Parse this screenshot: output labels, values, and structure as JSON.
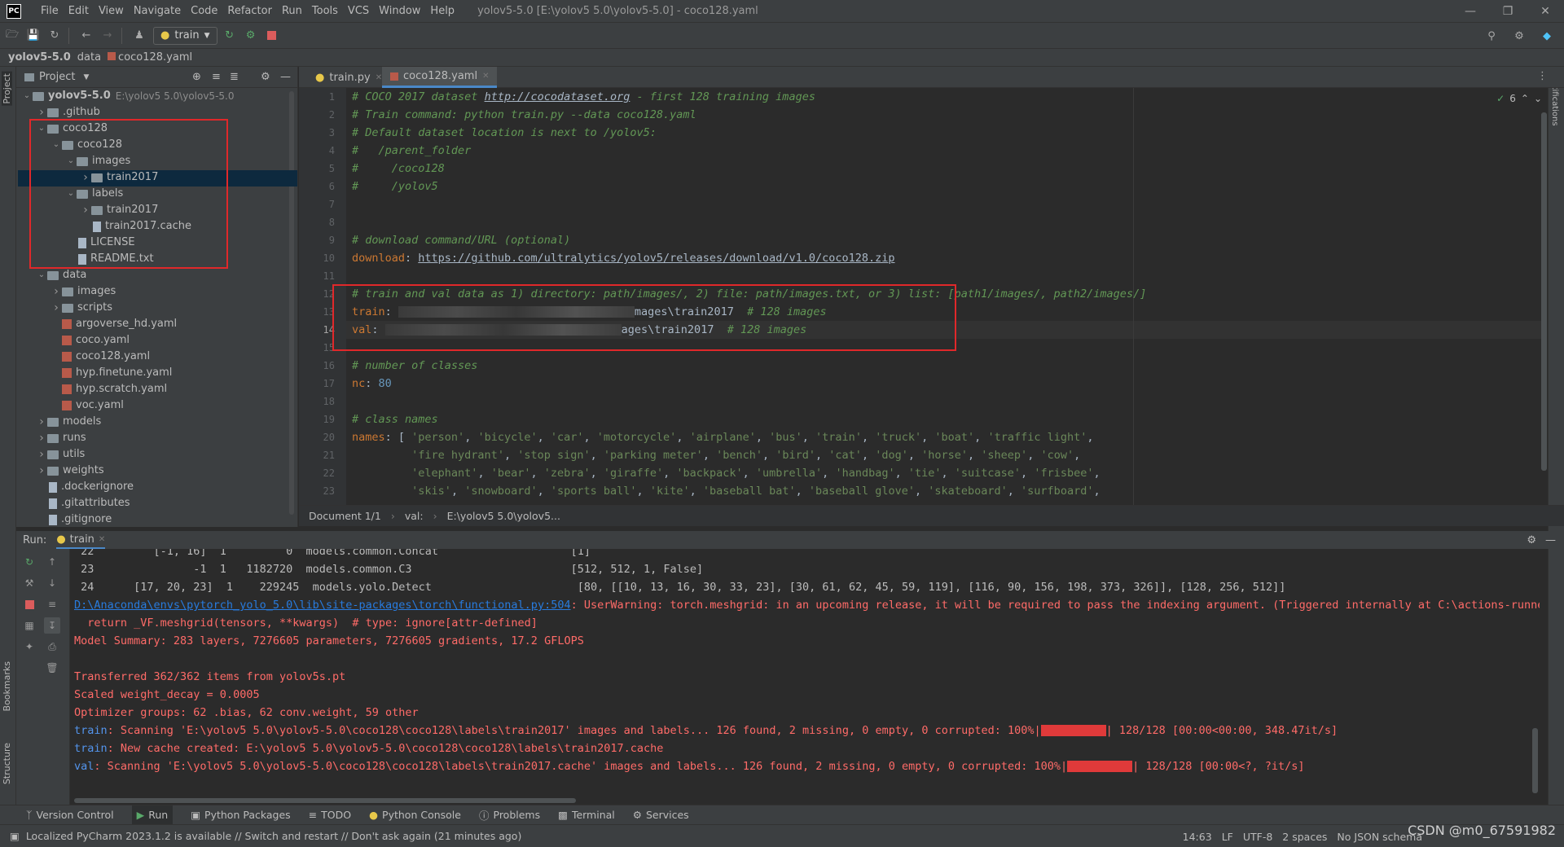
{
  "window": {
    "logo": "PC",
    "title": "yolov5-5.0 [E:\\yolov5 5.0\\yolov5-5.0] - coco128.yaml",
    "menu": [
      "File",
      "Edit",
      "View",
      "Navigate",
      "Code",
      "Refactor",
      "Run",
      "Tools",
      "VCS",
      "Window",
      "Help"
    ]
  },
  "toolbar": {
    "run_config": "train"
  },
  "breadcrumb": [
    "yolov5-5.0",
    "data",
    "coco128.yaml"
  ],
  "side_tabs": {
    "project": "Project",
    "bookmarks": "Bookmarks",
    "structure": "Structure",
    "notifications": "Notifications"
  },
  "project": {
    "header": "Project",
    "tree": [
      {
        "label": "yolov5-5.0",
        "hint": "E:\\yolov5 5.0\\yolov5-5.0",
        "kind": "folder",
        "depth": 0,
        "open": true,
        "bold": true
      },
      {
        "label": ".github",
        "kind": "folder",
        "depth": 1,
        "open": false
      },
      {
        "label": "coco128",
        "kind": "folder",
        "depth": 1,
        "open": true
      },
      {
        "label": "coco128",
        "kind": "folder",
        "depth": 2,
        "open": true
      },
      {
        "label": "images",
        "kind": "folder",
        "depth": 3,
        "open": true
      },
      {
        "label": "train2017",
        "kind": "folder",
        "depth": 4,
        "open": false,
        "selected": true
      },
      {
        "label": "labels",
        "kind": "folder",
        "depth": 3,
        "open": true
      },
      {
        "label": "train2017",
        "kind": "folder",
        "depth": 4,
        "open": false
      },
      {
        "label": "train2017.cache",
        "kind": "file",
        "depth": 4
      },
      {
        "label": "LICENSE",
        "kind": "file",
        "depth": 3
      },
      {
        "label": "README.txt",
        "kind": "file",
        "depth": 3
      },
      {
        "label": "data",
        "kind": "folder",
        "depth": 1,
        "open": true
      },
      {
        "label": "images",
        "kind": "folder",
        "depth": 2,
        "open": false
      },
      {
        "label": "scripts",
        "kind": "folder",
        "depth": 2,
        "open": false
      },
      {
        "label": "argoverse_hd.yaml",
        "kind": "yaml",
        "depth": 2
      },
      {
        "label": "coco.yaml",
        "kind": "yaml",
        "depth": 2
      },
      {
        "label": "coco128.yaml",
        "kind": "yaml",
        "depth": 2
      },
      {
        "label": "hyp.finetune.yaml",
        "kind": "yaml",
        "depth": 2
      },
      {
        "label": "hyp.scratch.yaml",
        "kind": "yaml",
        "depth": 2
      },
      {
        "label": "voc.yaml",
        "kind": "yaml",
        "depth": 2
      },
      {
        "label": "models",
        "kind": "folder",
        "depth": 1,
        "open": false
      },
      {
        "label": "runs",
        "kind": "folder",
        "depth": 1,
        "open": false
      },
      {
        "label": "utils",
        "kind": "folder",
        "depth": 1,
        "open": false
      },
      {
        "label": "weights",
        "kind": "folder",
        "depth": 1,
        "open": false
      },
      {
        "label": ".dockerignore",
        "kind": "file",
        "depth": 1
      },
      {
        "label": ".gitattributes",
        "kind": "file",
        "depth": 1
      },
      {
        "label": ".gitignore",
        "kind": "file",
        "depth": 1
      }
    ]
  },
  "editor": {
    "tabs": [
      {
        "label": "train.py",
        "active": false
      },
      {
        "label": "coco128.yaml",
        "active": true
      }
    ],
    "inspection_count": "6",
    "breadcrumb": [
      "Document 1/1",
      "val:",
      "E:\\yolov5 5.0\\yolov5..."
    ],
    "lines": [
      [
        [
          "cm",
          "# COCO 2017 dataset "
        ],
        [
          "cm link",
          "http://cocodataset.org"
        ],
        [
          "cm",
          " - first 128 training images"
        ]
      ],
      [
        [
          "cm",
          "# Train command: python train.py --data coco128.yaml"
        ]
      ],
      [
        [
          "cm",
          "# Default dataset location is next to /yolov5:"
        ]
      ],
      [
        [
          "cm",
          "#   /parent_folder"
        ]
      ],
      [
        [
          "cm",
          "#     /coco128"
        ]
      ],
      [
        [
          "cm",
          "#     /yolov5"
        ]
      ],
      [],
      [],
      [
        [
          "cm",
          "# download command/URL (optional)"
        ]
      ],
      [
        [
          "key",
          "download"
        ],
        [
          "plain",
          ": "
        ],
        [
          "link",
          "https://github.com/ultralytics/yolov5/releases/download/v1.0/coco128.zip"
        ]
      ],
      [],
      [
        [
          "cm",
          "# train and val data as 1) directory: path/images/, 2) file: path/images.txt, or 3) list: [path1/images/, path2/images/]"
        ]
      ],
      [
        [
          "key",
          "train"
        ],
        [
          "plain",
          ": "
        ],
        [
          "blur",
          "                                     "
        ],
        [
          "plain",
          "mages\\train2017  "
        ],
        [
          "cm",
          "# 128 images"
        ]
      ],
      [
        [
          "key",
          "val"
        ],
        [
          "plain",
          ": "
        ],
        [
          "blur",
          "                                     "
        ],
        [
          "plain",
          "ages\\train2017  "
        ],
        [
          "cm",
          "# 128 images"
        ]
      ],
      [],
      [
        [
          "cm",
          "# number of classes"
        ]
      ],
      [
        [
          "key",
          "nc"
        ],
        [
          "plain",
          ": "
        ],
        [
          "num",
          "80"
        ]
      ],
      [],
      [
        [
          "cm",
          "# class names"
        ]
      ],
      [
        [
          "key",
          "names"
        ],
        [
          "plain",
          ": [ "
        ],
        [
          "str",
          "'person'"
        ],
        [
          "plain",
          ", "
        ],
        [
          "str",
          "'bicycle'"
        ],
        [
          "plain",
          ", "
        ],
        [
          "str",
          "'car'"
        ],
        [
          "plain",
          ", "
        ],
        [
          "str",
          "'motorcycle'"
        ],
        [
          "plain",
          ", "
        ],
        [
          "str",
          "'airplane'"
        ],
        [
          "plain",
          ", "
        ],
        [
          "str",
          "'bus'"
        ],
        [
          "plain",
          ", "
        ],
        [
          "str",
          "'train'"
        ],
        [
          "plain",
          ", "
        ],
        [
          "str",
          "'truck'"
        ],
        [
          "plain",
          ", "
        ],
        [
          "str",
          "'boat'"
        ],
        [
          "plain",
          ", "
        ],
        [
          "str",
          "'traffic light'"
        ],
        [
          "plain",
          ","
        ]
      ],
      [
        [
          "plain",
          "         "
        ],
        [
          "str",
          "'fire hydrant'"
        ],
        [
          "plain",
          ", "
        ],
        [
          "str",
          "'stop sign'"
        ],
        [
          "plain",
          ", "
        ],
        [
          "str",
          "'parking meter'"
        ],
        [
          "plain",
          ", "
        ],
        [
          "str",
          "'bench'"
        ],
        [
          "plain",
          ", "
        ],
        [
          "str",
          "'bird'"
        ],
        [
          "plain",
          ", "
        ],
        [
          "str",
          "'cat'"
        ],
        [
          "plain",
          ", "
        ],
        [
          "str",
          "'dog'"
        ],
        [
          "plain",
          ", "
        ],
        [
          "str",
          "'horse'"
        ],
        [
          "plain",
          ", "
        ],
        [
          "str",
          "'sheep'"
        ],
        [
          "plain",
          ", "
        ],
        [
          "str",
          "'cow'"
        ],
        [
          "plain",
          ","
        ]
      ],
      [
        [
          "plain",
          "         "
        ],
        [
          "str",
          "'elephant'"
        ],
        [
          "plain",
          ", "
        ],
        [
          "str",
          "'bear'"
        ],
        [
          "plain",
          ", "
        ],
        [
          "str",
          "'zebra'"
        ],
        [
          "plain",
          ", "
        ],
        [
          "str",
          "'giraffe'"
        ],
        [
          "plain",
          ", "
        ],
        [
          "str",
          "'backpack'"
        ],
        [
          "plain",
          ", "
        ],
        [
          "str",
          "'umbrella'"
        ],
        [
          "plain",
          ", "
        ],
        [
          "str",
          "'handbag'"
        ],
        [
          "plain",
          ", "
        ],
        [
          "str",
          "'tie'"
        ],
        [
          "plain",
          ", "
        ],
        [
          "str",
          "'suitcase'"
        ],
        [
          "plain",
          ", "
        ],
        [
          "str",
          "'frisbee'"
        ],
        [
          "plain",
          ","
        ]
      ],
      [
        [
          "plain",
          "         "
        ],
        [
          "str",
          "'skis'"
        ],
        [
          "plain",
          ", "
        ],
        [
          "str",
          "'snowboard'"
        ],
        [
          "plain",
          ", "
        ],
        [
          "str",
          "'sports ball'"
        ],
        [
          "plain",
          ", "
        ],
        [
          "str",
          "'kite'"
        ],
        [
          "plain",
          ", "
        ],
        [
          "str",
          "'baseball bat'"
        ],
        [
          "plain",
          ", "
        ],
        [
          "str",
          "'baseball glove'"
        ],
        [
          "plain",
          ", "
        ],
        [
          "str",
          "'skateboard'"
        ],
        [
          "plain",
          ", "
        ],
        [
          "str",
          "'surfboard'"
        ],
        [
          "plain",
          ","
        ]
      ]
    ]
  },
  "run": {
    "label": "Run:",
    "tab": "train",
    "console": [
      [
        [
          "out",
          " 22         [-1, 16]  1         0  models.common.Concat                    [1]"
        ]
      ],
      [
        [
          "out",
          " 23               -1  1   1182720  models.common.C3                        [512, 512, 1, False]"
        ]
      ],
      [
        [
          "out",
          " 24      [17, 20, 23]  1    229245  models.yolo.Detect                      [80, [[10, 13, 16, 30, 33, 23], [30, 61, 62, 45, 59, 119], [116, 90, 156, 198, 373, 326]], [128, 256, 512]]"
        ]
      ],
      [
        [
          "ulink",
          "D:\\Anaconda\\envs\\pytorch_yolo_5.0\\lib\\site-packages\\torch\\functional.py:504"
        ],
        [
          "err",
          ": UserWarning: torch.meshgrid: in an upcoming release, it will be required to pass the indexing argument. (Triggered internally at C:\\actions-runner\\_w"
        ]
      ],
      [
        [
          "err",
          "  return _VF.meshgrid(tensors, **kwargs)  # type: ignore[attr-defined]"
        ]
      ],
      [
        [
          "err",
          "Model Summary: 283 layers, 7276605 parameters, 7276605 gradients, 17.2 GFLOPS"
        ]
      ],
      [],
      [
        [
          "err",
          "Transferred 362/362 items from yolov5s.pt"
        ]
      ],
      [
        [
          "err",
          "Scaled weight_decay = 0.0005"
        ]
      ],
      [
        [
          "err",
          "Optimizer groups: 62 .bias, 62 conv.weight, 59 other"
        ]
      ],
      [
        [
          "blue",
          "train"
        ],
        [
          "err",
          ": Scanning 'E:\\yolov5 5.0\\yolov5-5.0\\coco128\\coco128\\labels\\train2017' images and labels... 126 found, 2 missing, 0 empty, 0 corrupted: 100%|"
        ],
        [
          "bar",
          ""
        ],
        [
          "err",
          "| 128/128 [00:00<00:00, 348.47it/s]"
        ]
      ],
      [
        [
          "blue",
          "train"
        ],
        [
          "err",
          ": New cache created: E:\\yolov5 5.0\\yolov5-5.0\\coco128\\coco128\\labels\\train2017.cache"
        ]
      ],
      [
        [
          "blue",
          "val"
        ],
        [
          "err",
          ": Scanning 'E:\\yolov5 5.0\\yolov5-5.0\\coco128\\coco128\\labels\\train2017.cache' images and labels... 126 found, 2 missing, 0 empty, 0 corrupted: 100%|"
        ],
        [
          "bar",
          ""
        ],
        [
          "err",
          "| 128/128 [00:00<?, ?it/s]"
        ]
      ]
    ]
  },
  "bottom_tabs": [
    "Version Control",
    "Run",
    "Python Packages",
    "TODO",
    "Python Console",
    "Problems",
    "Terminal",
    "Services"
  ],
  "status": {
    "message": "Localized PyCharm 2023.1.2 is available // Switch and restart // Don't ask again (21 minutes ago)",
    "position": "14:63",
    "line_sep": "LF",
    "encoding": "UTF-8",
    "indent": "2 spaces",
    "schema": "No JSON schema"
  },
  "watermark": "CSDN @m0_67591982"
}
